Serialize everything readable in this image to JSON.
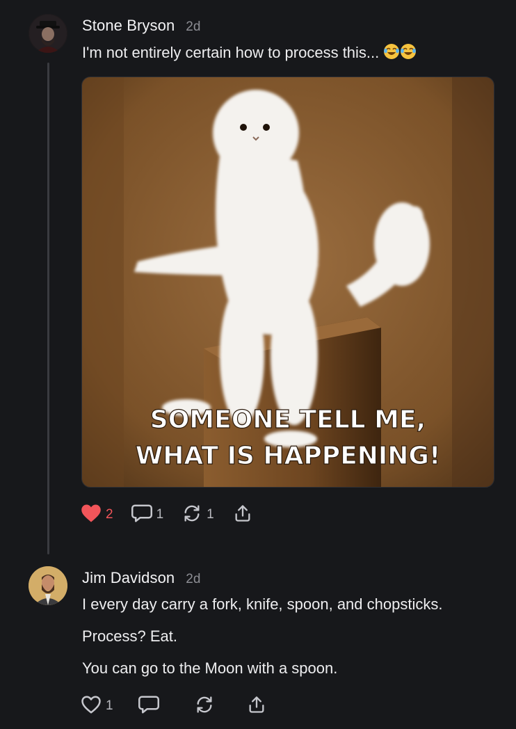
{
  "posts": [
    {
      "author": "Stone Bryson",
      "time": "2d",
      "text": "I'm not entirely certain how to process this...",
      "emoji": [
        "face-with-tears-of-joy-icon",
        "face-with-tears-of-joy-icon"
      ],
      "media_caption_line1": "SOMEONE TELL ME,",
      "media_caption_line2": "WHAT IS HAPPENING!",
      "likes": "2",
      "liked": true,
      "replies": "1",
      "reposts": "1",
      "like_color": "#f2555a"
    },
    {
      "author": "Jim Davidson",
      "time": "2d",
      "lines": [
        "I every day carry a fork, knife, spoon, and chopsticks.",
        "Process? Eat.",
        "You can go to the Moon with a spoon."
      ],
      "likes": "1",
      "liked": false
    }
  ]
}
